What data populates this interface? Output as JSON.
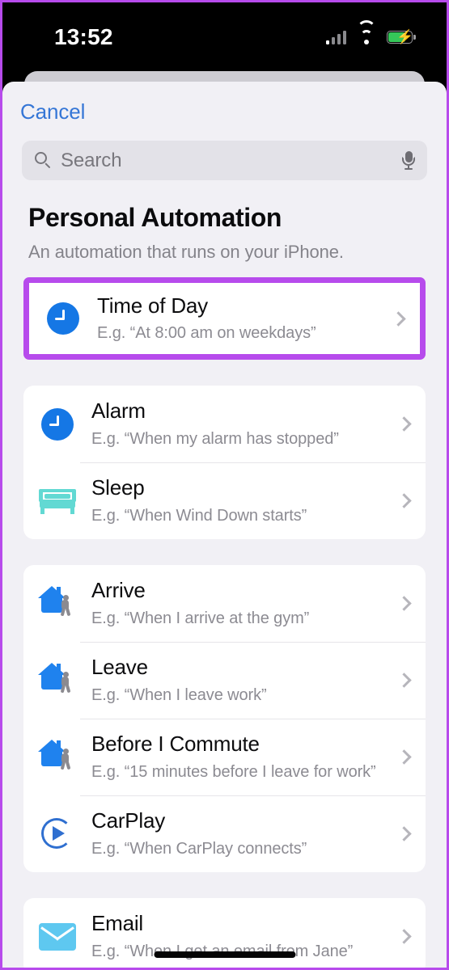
{
  "status_bar": {
    "time": "13:52",
    "cellular_icon": "signal-bars-icon",
    "wifi_icon": "wifi-icon",
    "battery_icon": "battery-charging-icon"
  },
  "header": {
    "cancel_label": "Cancel"
  },
  "search": {
    "placeholder": "Search",
    "value": "",
    "search_icon": "search-icon",
    "mic_icon": "microphone-icon"
  },
  "page": {
    "title": "Personal Automation",
    "subtitle": "An automation that runs on your iPhone."
  },
  "colors": {
    "accent_blue": "#3576d6",
    "highlight_purple": "#b74bec",
    "clock_blue": "#1577e5",
    "bed_teal": "#62d9d3",
    "house_blue": "#1f82ee",
    "carplay_blue": "#2f6fd0",
    "mail_blue": "#5ec8f0",
    "sheet_bg": "#f1f0f5",
    "card_bg": "#ffffff"
  },
  "groups": [
    {
      "highlighted": true,
      "rows": [
        {
          "title": "Time of Day",
          "subtitle": "E.g. “At 8:00 am on weekdays”",
          "icon": "clock-icon"
        }
      ]
    },
    {
      "highlighted": false,
      "rows": [
        {
          "title": "Alarm",
          "subtitle": "E.g. “When my alarm has stopped”",
          "icon": "clock-icon"
        },
        {
          "title": "Sleep",
          "subtitle": "E.g. “When Wind Down starts”",
          "icon": "bed-icon"
        }
      ]
    },
    {
      "highlighted": false,
      "rows": [
        {
          "title": "Arrive",
          "subtitle": "E.g. “When I arrive at the gym”",
          "icon": "home-person-icon"
        },
        {
          "title": "Leave",
          "subtitle": "E.g. “When I leave work”",
          "icon": "home-person-icon"
        },
        {
          "title": "Before I Commute",
          "subtitle": "E.g. “15 minutes before I leave for work”",
          "icon": "home-person-icon"
        },
        {
          "title": "CarPlay",
          "subtitle": "E.g. “When CarPlay connects”",
          "icon": "carplay-icon"
        }
      ]
    },
    {
      "highlighted": false,
      "rows": [
        {
          "title": "Email",
          "subtitle": "E.g. “When I get an email from Jane”",
          "icon": "mail-icon"
        }
      ]
    }
  ]
}
